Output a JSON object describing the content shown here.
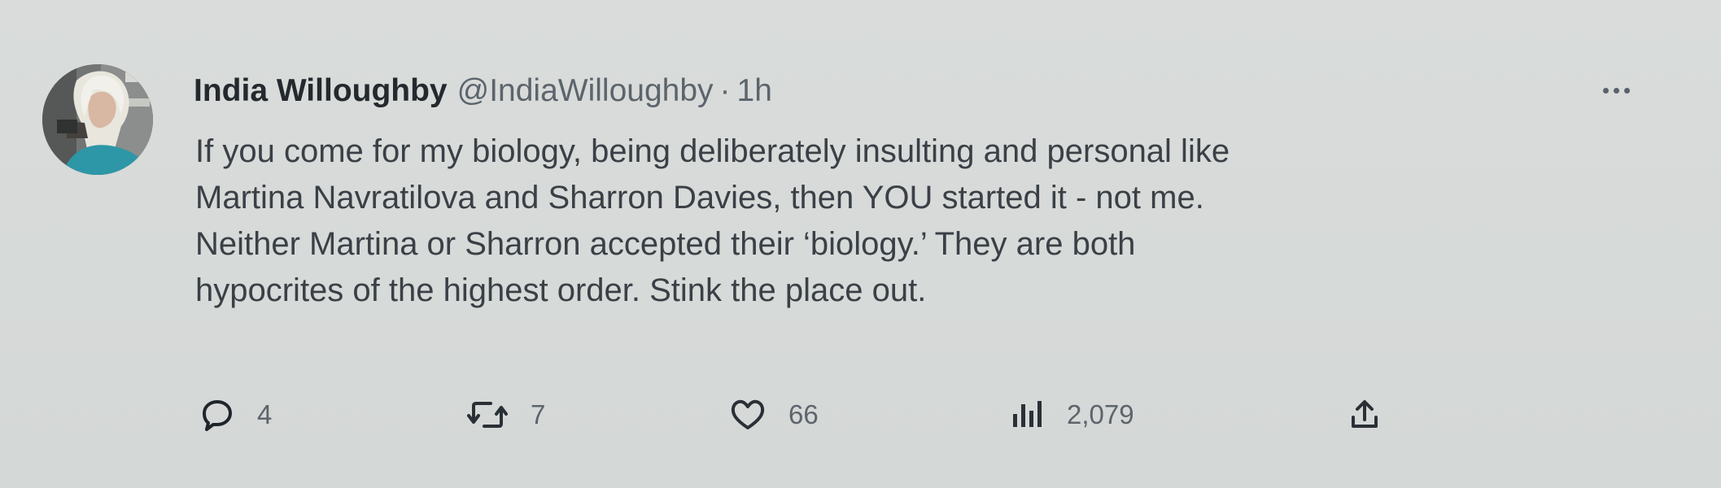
{
  "tweet": {
    "author_name": "India Willoughby",
    "handle": "@IndiaWilloughby",
    "separator": "·",
    "time": "1h",
    "text_lines": [
      "If you come for my biology, being deliberately insulting and personal like",
      "Martina Navratilova and Sharron Davies, then YOU started it - not me.",
      "Neither Martina or Sharron accepted their ‘biology.’ They are both",
      "hypocrites of the highest order. Stink the place out."
    ]
  },
  "actions": {
    "reply_count": "4",
    "retweet_count": "7",
    "like_count": "66",
    "view_count": "2,079"
  },
  "icons": {
    "avatar": "profile-photo",
    "more": "more-icon",
    "reply": "reply-icon",
    "retweet": "retweet-icon",
    "like": "heart-icon",
    "views": "views-icon",
    "share": "share-icon"
  },
  "colors": {
    "background": "#d7dad8",
    "text": "#2b3036",
    "muted": "#5d646b",
    "avatar_accent": "#2d97a7"
  }
}
